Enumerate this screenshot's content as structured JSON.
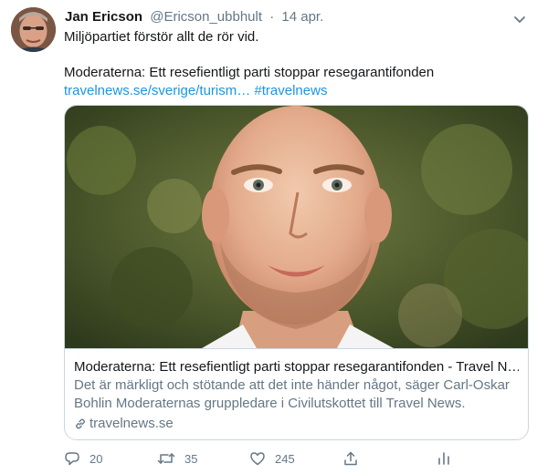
{
  "author": {
    "name": "Jan Ericson",
    "handle": "@Ericson_ubbhult",
    "separator": "·",
    "date": "14 apr."
  },
  "tweet": {
    "line1": "Miljöpartiet förstör allt de rör vid.",
    "line2": "Moderaterna: Ett resefientligt parti stoppar resegarantifonden",
    "link_url": "travelnews.se/sverige/turism…",
    "hashtag": "#travelnews"
  },
  "card": {
    "title": "Moderaterna: Ett resefientligt parti stoppar resegarantifonden - Travel N…",
    "description_line1": "Det är märkligt och stötande att det inte händer något, säger Carl-Oskar",
    "description_line2": "Bohlin Moderaternas gruppledare i Civilutskottet till Travel News.",
    "domain": "travelnews.se"
  },
  "actions": {
    "reply_count": "20",
    "retweet_count": "35",
    "like_count": "245"
  },
  "icons": {
    "reply": "reply-icon",
    "retweet": "retweet-icon",
    "like": "heart-icon",
    "share": "share-icon",
    "analytics": "analytics-icon",
    "caret": "chevron-down-icon",
    "link": "link-icon"
  },
  "colors": {
    "link": "#1b95e0",
    "secondary_text": "#657786",
    "primary_text": "#14171a",
    "border": "#ccd6dd"
  }
}
